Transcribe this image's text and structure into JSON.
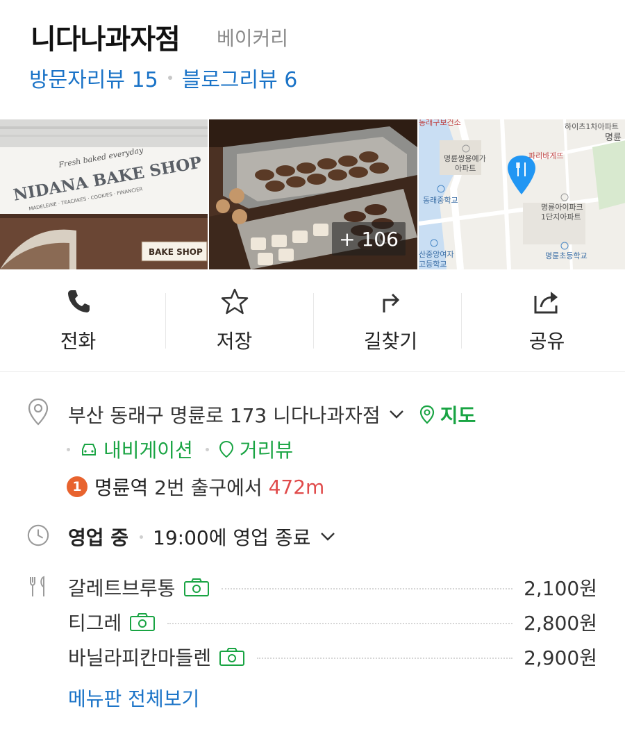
{
  "place": {
    "name": "니다나과자점",
    "category": "베이커리",
    "visitor_review": "방문자리뷰 15",
    "blog_review": "블로그리뷰 6"
  },
  "photos": {
    "shop_sign_main": "NIDANA BAKE SHOP",
    "shop_sign_script": "Fresh baked everyday",
    "shop_sign_sub": "MADELEINE · TEACAKES · COOKIES · FINANCIER",
    "shop_small_sign": "BAKE SHOP",
    "more_count": "+ 106",
    "map_labels": {
      "top_left": "동래구보건소",
      "top_right": "하이츠1차아파트",
      "top_right2": "명륜",
      "bakery": "파리바게뜨",
      "apt1a": "명륜쌍용예가",
      "apt1b": "아파트",
      "school1": "동래중학교",
      "apt2a": "명륜아이파크",
      "apt2b": "1단지아파트",
      "school2": "명륜초등학교",
      "school3a": "산중앙여자",
      "school3b": "고등학교"
    }
  },
  "actions": [
    {
      "label": "전화",
      "icon": "phone-icon"
    },
    {
      "label": "저장",
      "icon": "star-icon"
    },
    {
      "label": "길찾기",
      "icon": "directions-icon"
    },
    {
      "label": "공유",
      "icon": "share-icon"
    }
  ],
  "info": {
    "address": "부산 동래구 명륜로 173 니다나과자점",
    "map_link": "지도",
    "navigation_link": "내비게이션",
    "streetview_link": "거리뷰",
    "station_number": "1",
    "station_name": "명륜역",
    "station_exit": " 2번 출구에서 ",
    "station_distance": "472m",
    "hours_status": "영업 중",
    "hours_detail": "19:00에 영업 종료"
  },
  "menu": [
    {
      "name": "갈레트브루통",
      "price": "2,100원"
    },
    {
      "name": "티그레",
      "price": "2,800원"
    },
    {
      "name": "바닐라피칸마들렌",
      "price": "2,900원"
    }
  ],
  "menu_more": "메뉴판 전체보기",
  "colors": {
    "link_blue": "#1a73c7",
    "link_green": "#19a443",
    "distance_red": "#e04b4b",
    "badge_orange": "#e8632e"
  }
}
